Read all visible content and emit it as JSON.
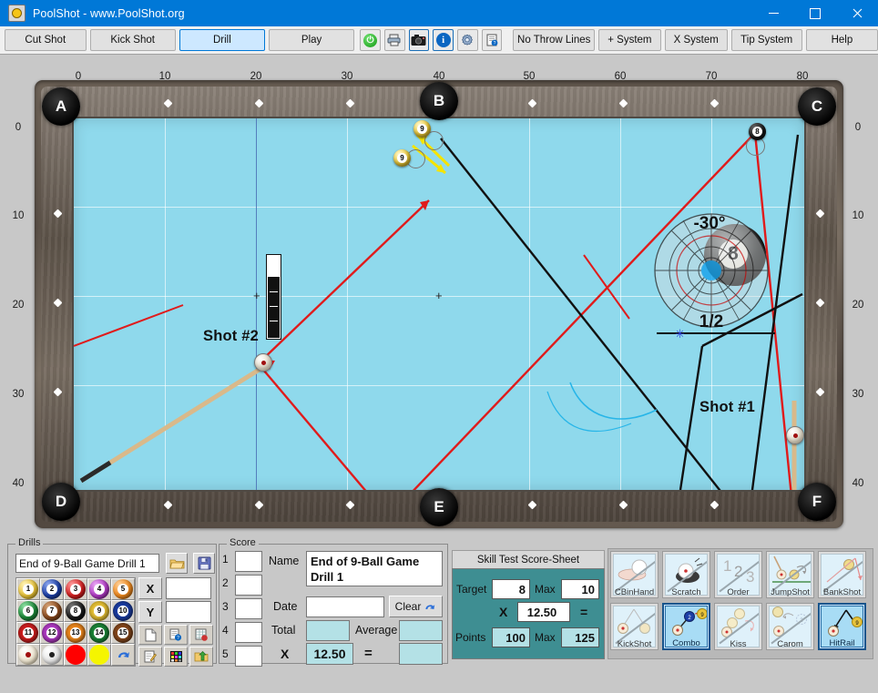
{
  "window": {
    "title": "PoolShot - www.PoolShot.org",
    "icon": "app-icon",
    "minimize": "—",
    "maximize": "□",
    "close": "✕"
  },
  "toolbar": {
    "modes": [
      {
        "label": "Cut Shot",
        "selected": false
      },
      {
        "label": "Kick Shot",
        "selected": false
      },
      {
        "label": "Drill",
        "selected": true
      },
      {
        "label": "Play",
        "selected": false
      }
    ],
    "icons": [
      {
        "name": "power-icon",
        "glyph": "⏻"
      },
      {
        "name": "print-icon",
        "glyph": "⎙"
      },
      {
        "name": "camera-icon",
        "glyph": "◉"
      },
      {
        "name": "info-icon",
        "glyph": "i"
      },
      {
        "name": "settings-gear-icon",
        "glyph": "⚙"
      },
      {
        "name": "help-document-icon",
        "glyph": "?"
      }
    ],
    "systems": [
      {
        "label": "No Throw Lines"
      },
      {
        "label": "+ System"
      },
      {
        "label": "X System"
      },
      {
        "label": "Tip System"
      },
      {
        "label": "Help"
      }
    ]
  },
  "table": {
    "top_ruler": [
      "0",
      "10",
      "20",
      "30",
      "40",
      "50",
      "60",
      "70",
      "80"
    ],
    "left_ruler": [
      "0",
      "10",
      "20",
      "30",
      "40"
    ],
    "right_ruler": [
      "0",
      "10",
      "20",
      "30",
      "40"
    ],
    "pockets": [
      {
        "id": "A",
        "label": "A"
      },
      {
        "id": "B",
        "label": "B"
      },
      {
        "id": "C",
        "label": "C"
      },
      {
        "id": "D",
        "label": "D"
      },
      {
        "id": "E",
        "label": "E"
      },
      {
        "id": "F",
        "label": "F"
      }
    ],
    "shot_labels": [
      {
        "name": "shot-2-label",
        "text": "Shot #2"
      },
      {
        "name": "shot-1-label",
        "text": "Shot #1"
      }
    ],
    "balls": [
      {
        "name": "nine-ball-upper",
        "number": "9",
        "color": "#f2d03c"
      },
      {
        "name": "nine-ball-lower",
        "number": "9",
        "color": "#f2d03c"
      },
      {
        "name": "eight-ball-corner",
        "number": "8",
        "color": "#1a1a1a"
      },
      {
        "name": "eight-ball-target",
        "number": "8",
        "color": "#1a1a1a"
      }
    ],
    "aim_overlay": {
      "angle_label": "-30°",
      "fraction_label": "1/2"
    },
    "felt_color": "#8fd9ec",
    "line_colors": {
      "path_red": "#e01b1b",
      "path_black": "#111111",
      "path_yellow": "#f5e400",
      "path_cyan": "#27b5e8"
    }
  },
  "drills": {
    "group_label": "Drills",
    "name_value": "End of 9-Ball Game Drill 1",
    "open_icon": "folder-open-icon",
    "save_icon": "floppy-save-icon",
    "balls": [
      {
        "n": "1",
        "color": "#e8c33a",
        "stripe": false
      },
      {
        "n": "2",
        "color": "#1c3fa8",
        "stripe": false
      },
      {
        "n": "3",
        "color": "#d42020",
        "stripe": false
      },
      {
        "n": "4",
        "color": "#b43ec8",
        "stripe": false
      },
      {
        "n": "5",
        "color": "#f08a1e",
        "stripe": false
      },
      {
        "n": "6",
        "color": "#1d8a3a",
        "stripe": false
      },
      {
        "n": "7",
        "color": "#8a4a1e",
        "stripe": false
      },
      {
        "n": "8",
        "color": "#1a1a1a",
        "stripe": false
      },
      {
        "n": "9",
        "color": "#e8c33a",
        "stripe": true
      },
      {
        "n": "10",
        "color": "#1c3fa8",
        "stripe": true
      },
      {
        "n": "11",
        "color": "#d42020",
        "stripe": true
      },
      {
        "n": "12",
        "color": "#b43ec8",
        "stripe": true
      },
      {
        "n": "13",
        "color": "#f08a1e",
        "stripe": true
      },
      {
        "n": "14",
        "color": "#1d8a3a",
        "stripe": true
      },
      {
        "n": "15",
        "color": "#8a4a1e",
        "stripe": true
      }
    ],
    "extras": [
      {
        "name": "cue-ball-swatch",
        "kind": "cueball"
      },
      {
        "name": "ghost-ball-swatch",
        "kind": "ghost"
      },
      {
        "name": "red-spot-swatch",
        "kind": "red"
      },
      {
        "name": "yellow-spot-swatch",
        "kind": "yellow"
      },
      {
        "name": "undo-arrow-icon",
        "kind": "undo"
      }
    ],
    "coord": {
      "x_label": "X",
      "x_value": "",
      "y_label": "Y",
      "y_value": ""
    },
    "tools": [
      {
        "name": "new-page-icon"
      },
      {
        "name": "help-page-icon"
      },
      {
        "name": "table-report-icon"
      },
      {
        "name": "edit-note-icon"
      },
      {
        "name": "color-palette-icon"
      },
      {
        "name": "folder-export-icon"
      }
    ]
  },
  "score": {
    "group_label": "Score",
    "rows": [
      "1",
      "2",
      "3",
      "4",
      "5"
    ],
    "row_values": [
      "",
      "",
      "",
      "",
      ""
    ],
    "name_label": "Name",
    "name_value": "End of 9-Ball Game Drill 1",
    "date_label": "Date",
    "date_value": "",
    "clear_label": "Clear",
    "clear_icon": "undo-arrow-icon",
    "total_label": "Total",
    "total_value": "",
    "average_label": "Average",
    "average_value": "",
    "multiply_label": "X",
    "multiplier_value": "12.50",
    "equals_label": "=",
    "result_value": ""
  },
  "skill": {
    "header": "Skill Test Score-Sheet",
    "target_label": "Target",
    "target_value": "8",
    "target_max_label": "Max",
    "target_max_value": "10",
    "multiply_label": "X",
    "multiplier_value": "12.50",
    "equals_label": "=",
    "points_label": "Points",
    "points_value": "100",
    "points_max_label": "Max",
    "points_max_value": "125"
  },
  "shot_types": [
    {
      "label": "CBinHand",
      "name": "cb-in-hand-button",
      "selected": false,
      "disabled": true
    },
    {
      "label": "Scratch",
      "name": "scratch-button",
      "selected": false,
      "disabled": true
    },
    {
      "label": "Order",
      "name": "order-button",
      "selected": false,
      "disabled": true
    },
    {
      "label": "JumpShot",
      "name": "jump-shot-button",
      "selected": false,
      "disabled": true
    },
    {
      "label": "BankShot",
      "name": "bank-shot-button",
      "selected": false,
      "disabled": true
    },
    {
      "label": "KickShot",
      "name": "kick-shot-button",
      "selected": false,
      "disabled": true
    },
    {
      "label": "Combo",
      "name": "combo-button",
      "selected": true,
      "disabled": false
    },
    {
      "label": "Kiss",
      "name": "kiss-button",
      "selected": false,
      "disabled": true
    },
    {
      "label": "Carom",
      "name": "carom-button",
      "selected": false,
      "disabled": true
    },
    {
      "label": "HitRail",
      "name": "hit-rail-button",
      "selected": true,
      "disabled": false
    }
  ]
}
